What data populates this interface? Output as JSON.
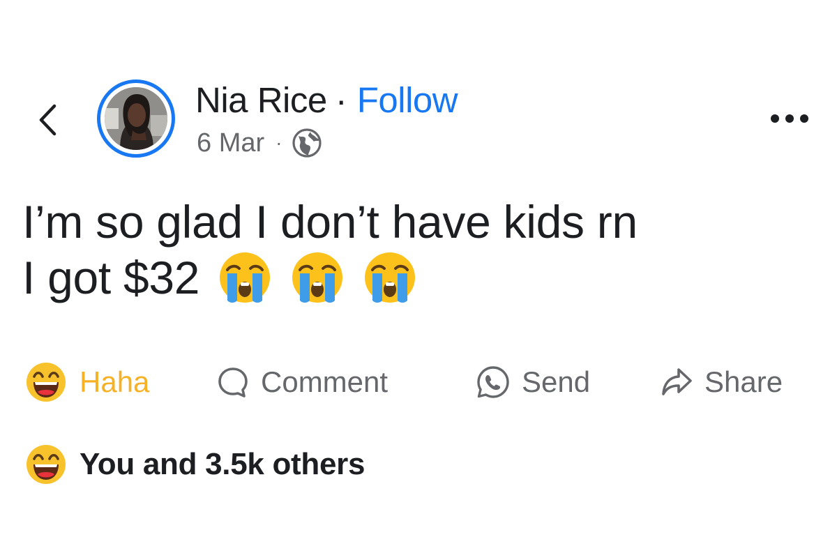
{
  "header": {
    "author_name": "Nia Rice",
    "separator": "·",
    "follow_label": "Follow",
    "date": "6 Mar",
    "meta_separator": "·",
    "audience_icon": "globe-icon",
    "more_icon": "more-options-icon",
    "back_icon": "chevron-left-icon"
  },
  "post": {
    "text_line_1": "I’m so glad I don’t have kids rn",
    "text_line_2": "I got $32",
    "emojis": [
      "loudly-crying-face",
      "loudly-crying-face",
      "loudly-crying-face"
    ]
  },
  "actions": {
    "haha_label": "Haha",
    "comment_label": "Comment",
    "send_label": "Send",
    "share_label": "Share"
  },
  "reactions": {
    "summary": "You and 3.5k others",
    "icon": "haha-reaction-icon"
  },
  "colors": {
    "accent_blue": "#1877f2",
    "haha_yellow": "#f7b125",
    "secondary_text": "#65676b",
    "primary_text": "#1c1e21"
  }
}
